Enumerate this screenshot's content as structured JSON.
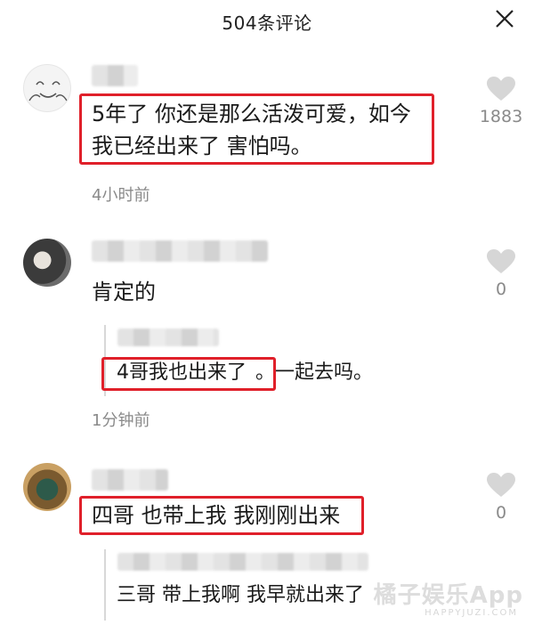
{
  "header": {
    "title": "504条评论"
  },
  "comments": [
    {
      "text_line1": "5年了 你还是那么活泼可爱，如今",
      "text_line2": "我已经出来了 害怕吗。",
      "time": "4小时前",
      "likes": "1883"
    },
    {
      "text": "肯定的",
      "reply_emphasis": "4哥我也出来了",
      "reply_rest": "。一起去吗。",
      "time": "1分钟前",
      "likes": "0"
    },
    {
      "text": "四哥 也带上我 我刚刚出来",
      "reply_text": "三哥 带上我啊 我早就出来了",
      "likes": "0"
    }
  ],
  "watermark": {
    "main": "橘子娱乐App",
    "sub": "HAPPYJUZI.COM"
  },
  "colors": {
    "highlight": "#e0202a",
    "heart": "#d6d6d6",
    "meta": "#8a8a8a"
  }
}
